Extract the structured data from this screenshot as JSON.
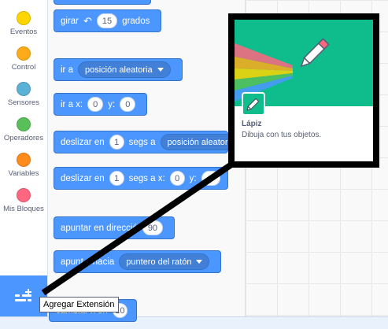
{
  "categories": [
    {
      "label": "Eventos",
      "color": "#ffd500"
    },
    {
      "label": "Control",
      "color": "#ffab19"
    },
    {
      "label": "Sensores",
      "color": "#5cb1d6"
    },
    {
      "label": "Operadores",
      "color": "#59c059"
    },
    {
      "label": "Variables",
      "color": "#ff8c1a"
    },
    {
      "label": "Mis Bloques",
      "color": "#ff6680"
    }
  ],
  "blocks": {
    "girar": {
      "label": "girar",
      "value": "15",
      "suffix": "grados"
    },
    "ir_a": {
      "label": "ir a",
      "dropdown": "posición aleatoria"
    },
    "ir_a_xy": {
      "label": "ir a x:",
      "x": "0",
      "ylabel": "y:",
      "y": "0"
    },
    "deslizar_a": {
      "label": "deslizar en",
      "secs": "1",
      "mid": "segs a",
      "dropdown": "posición aleatori"
    },
    "deslizar_xy": {
      "label": "deslizar en",
      "secs": "1",
      "mid": "segs a x:",
      "x": "0",
      "ylabel": "y:"
    },
    "apuntar_dir": {
      "label": "apuntar en direcció",
      "value": "90"
    },
    "apuntar_hacia": {
      "label": "apunt",
      "label2": "hacia",
      "dropdown": "puntero del ratón"
    },
    "cambiar_x": {
      "label": "cambiar x en",
      "value": "10"
    }
  },
  "extension": {
    "tooltip": "Agregar Extensión",
    "card_title": "Lápiz",
    "card_description": "Dibuja con tus objetos."
  },
  "colors": {
    "motion": "#4c97ff",
    "pen_green": "#0fbd8c"
  }
}
